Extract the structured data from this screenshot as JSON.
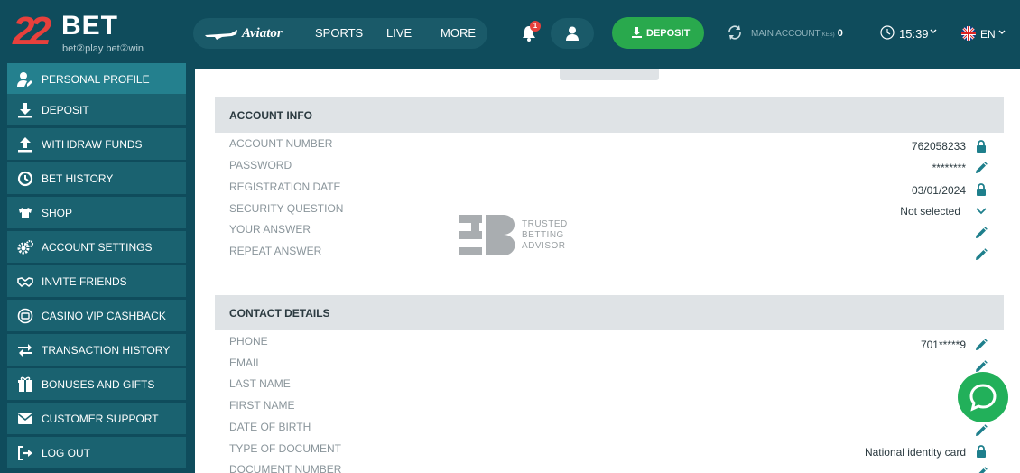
{
  "brand": {
    "logo_number": "22",
    "logo_text": "BET",
    "tagline": "bet②play bet②win"
  },
  "topnav": {
    "aviator": "Aviator",
    "sports": "SPORTS",
    "live": "LIVE",
    "more": "MORE"
  },
  "header": {
    "notifications_count": "1",
    "deposit_label": "DEPOSIT",
    "main_account_label": "MAIN ACCOUNT",
    "currency": "(KES)",
    "balance": "0",
    "time": "15:39",
    "language": "EN"
  },
  "sidebar": {
    "items": [
      {
        "label": "PERSONAL PROFILE",
        "icon": "user-edit-icon",
        "active": true
      },
      {
        "label": "DEPOSIT",
        "icon": "download-icon"
      },
      {
        "label": "WITHDRAW FUNDS",
        "icon": "upload-icon"
      },
      {
        "label": "BET HISTORY",
        "icon": "clock-icon"
      },
      {
        "label": "SHOP",
        "icon": "shirt-icon"
      },
      {
        "label": "ACCOUNT SETTINGS",
        "icon": "gear-icon"
      },
      {
        "label": "INVITE FRIENDS",
        "icon": "handshake-icon"
      },
      {
        "label": "CASINO VIP CASHBACK",
        "icon": "cashback-icon"
      },
      {
        "label": "TRANSACTION HISTORY",
        "icon": "transfer-icon"
      },
      {
        "label": "BONUSES AND GIFTS",
        "icon": "gift-icon"
      },
      {
        "label": "CUSTOMER SUPPORT",
        "icon": "mail-icon"
      },
      {
        "label": "LOG OUT",
        "icon": "logout-icon"
      }
    ]
  },
  "account_info": {
    "title": "ACCOUNT INFO",
    "rows": [
      {
        "label": "ACCOUNT NUMBER",
        "value": "762058233",
        "icon": "lock-icon"
      },
      {
        "label": "PASSWORD",
        "value": "********",
        "icon": "pencil-icon"
      },
      {
        "label": "REGISTRATION DATE",
        "value": "03/01/2024",
        "icon": "lock-icon"
      },
      {
        "label": "SECURITY QUESTION",
        "value": "Not selected",
        "icon": "chevron-down-icon"
      },
      {
        "label": "YOUR ANSWER",
        "value": "",
        "icon": "pencil-icon"
      },
      {
        "label": "REPEAT ANSWER",
        "value": "",
        "icon": "pencil-icon"
      }
    ]
  },
  "contact_details": {
    "title": "CONTACT DETAILS",
    "rows": [
      {
        "label": "PHONE",
        "value": "701*****9",
        "icon": "pencil-icon"
      },
      {
        "label": "EMAIL",
        "value": "",
        "icon": "pencil-icon"
      },
      {
        "label": "LAST NAME",
        "value": "",
        "icon": ""
      },
      {
        "label": "FIRST NAME",
        "value": "",
        "icon": ""
      },
      {
        "label": "DATE OF BIRTH",
        "value": "",
        "icon": "pencil-icon"
      },
      {
        "label": "TYPE OF DOCUMENT",
        "value": "National identity card",
        "icon": "lock-icon"
      },
      {
        "label": "DOCUMENT NUMBER",
        "value": "",
        "icon": "pencil-icon"
      }
    ]
  },
  "watermark": {
    "text": "TRUSTED BETTING ADVISOR"
  },
  "colors": {
    "header_bg": "#0f4c5c",
    "sidebar_item": "#1a6270",
    "accent": "#24808e",
    "deposit_green": "#29a94d",
    "logo_red": "#e8403c",
    "icon_teal": "#1e7f8c",
    "chat_green": "#22b05a"
  }
}
